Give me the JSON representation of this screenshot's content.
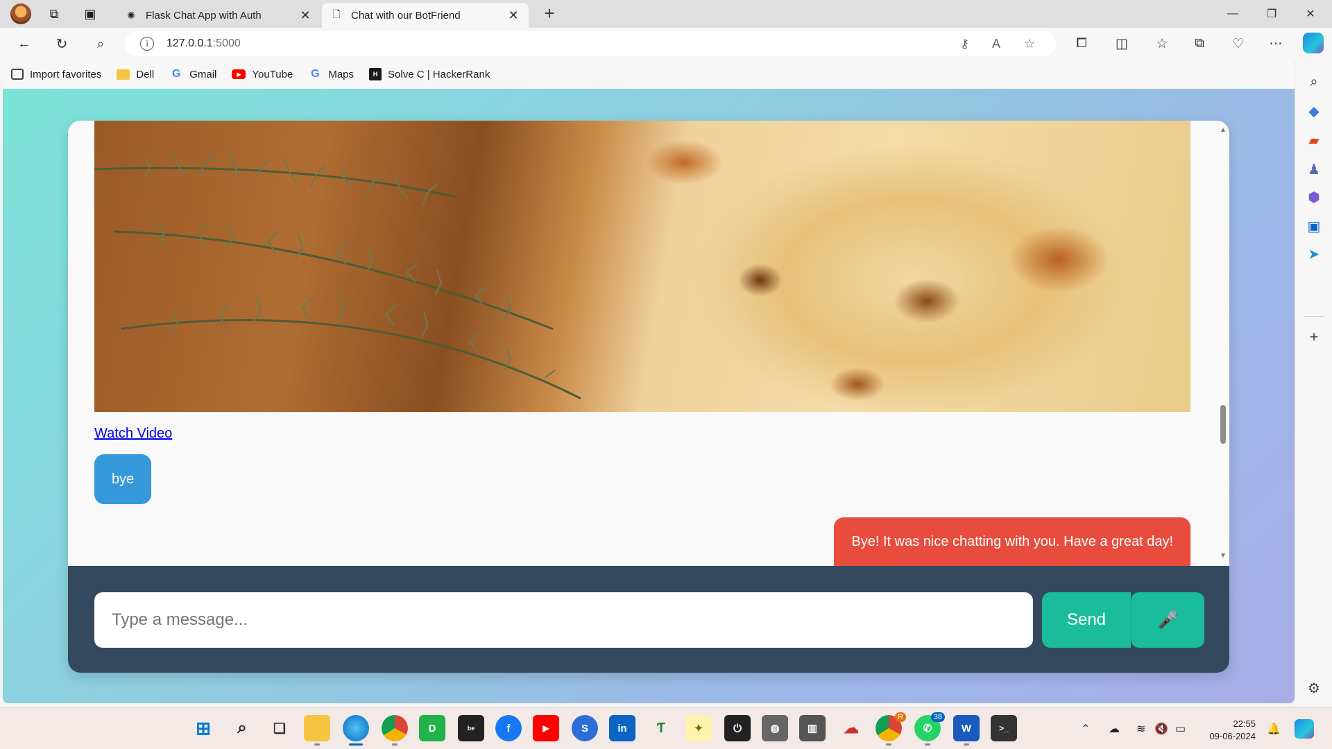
{
  "browser": {
    "tabs": [
      {
        "title": "Flask Chat App with Auth",
        "active": false
      },
      {
        "title": "Chat with our BotFriend",
        "active": true
      }
    ],
    "new_tab": "+",
    "close_glyph": "✕",
    "window_controls": {
      "minimize": "—",
      "maximize": "❐",
      "close": "✕"
    },
    "address": {
      "host": "127.0.0.1",
      "port": ":5000"
    },
    "favorites": [
      {
        "label": "Import favorites",
        "icon": "import-icon"
      },
      {
        "label": "Dell",
        "icon": "folder-icon"
      },
      {
        "label": "Gmail",
        "icon": "google-icon"
      },
      {
        "label": "YouTube",
        "icon": "youtube-icon"
      },
      {
        "label": "Maps",
        "icon": "google-icon"
      },
      {
        "label": "Solve C | HackerRank",
        "icon": "hackerrank-icon"
      }
    ]
  },
  "chat": {
    "link_text": "Watch Video",
    "user_message": "bye",
    "bot_message": "Bye! It was nice chatting with you. Have a great day!",
    "input_placeholder": "Type a message...",
    "input_value": "",
    "send_label": "Send",
    "mic_icon": "🎤",
    "colors": {
      "user_bubble": "#3498db",
      "bot_bubble": "#e74c3c",
      "send_button": "#1abc9c",
      "composer_bg": "#34495e"
    }
  },
  "taskbar": {
    "time": "22:55",
    "date": "09-06-2024",
    "whatsapp_badge": "38",
    "chrome_badge": "R"
  }
}
